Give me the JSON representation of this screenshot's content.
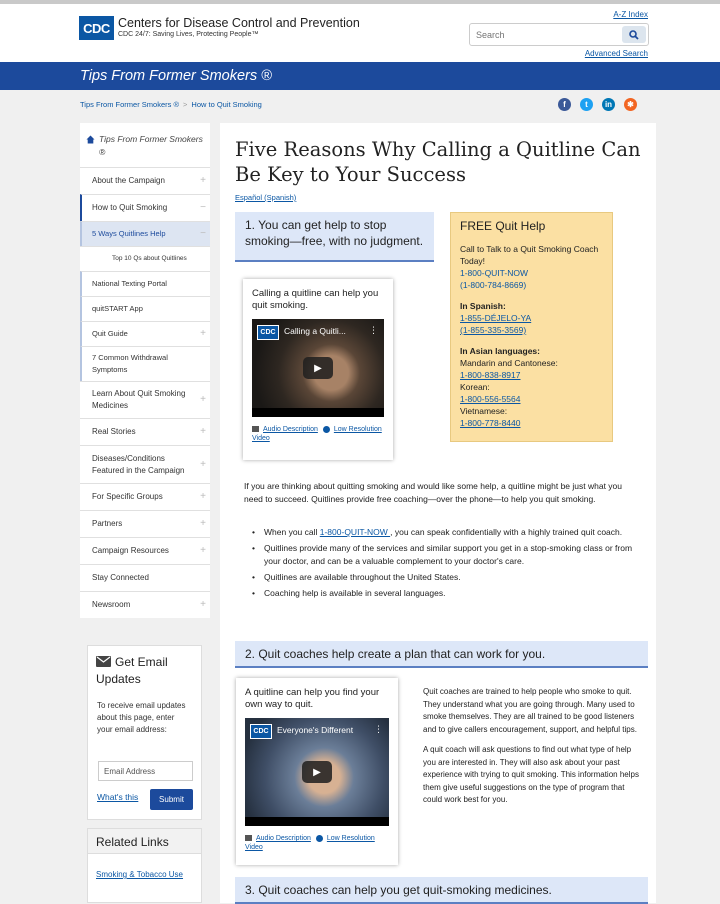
{
  "header": {
    "logo_mark": "CDC",
    "org_name": "Centers for Disease Control and Prevention",
    "tagline": "CDC 24/7: Saving Lives, Protecting People™",
    "az_index": "A-Z Index",
    "search_placeholder": "Search",
    "advanced_search": "Advanced Search",
    "search_icon": "search-icon"
  },
  "banner": {
    "title": "Tips From Former Smokers ®"
  },
  "breadcrumb": {
    "items": [
      "Tips From Former Smokers ®",
      "How to Quit Smoking"
    ],
    "separator": ">"
  },
  "social": [
    {
      "icon": "facebook-icon",
      "glyph": "f",
      "color": "#3b5998"
    },
    {
      "icon": "twitter-icon",
      "glyph": "t",
      "color": "#1da1f2"
    },
    {
      "icon": "linkedin-icon",
      "glyph": "in",
      "color": "#0077b5"
    },
    {
      "icon": "syndicate-icon",
      "glyph": "✱",
      "color": "#f26522"
    }
  ],
  "sidebar": {
    "home_label": "Tips From Former Smokers ®",
    "items": [
      {
        "label": "About the Campaign",
        "toggle": "+"
      },
      {
        "label": "How to Quit Smoking",
        "toggle": "−"
      },
      {
        "label": "5 Ways Quitlines Help",
        "toggle": "−"
      },
      {
        "label": "Top 10 Qs about Quitlines",
        "toggle": ""
      },
      {
        "label": "National Texting Portal",
        "toggle": ""
      },
      {
        "label": "quitSTART App",
        "toggle": ""
      },
      {
        "label": "Quit Guide",
        "toggle": "+"
      },
      {
        "label": "7 Common Withdrawal Symptoms",
        "toggle": ""
      },
      {
        "label": "Learn About Quit Smoking Medicines",
        "toggle": "+"
      },
      {
        "label": "Real Stories",
        "toggle": "+"
      },
      {
        "label": "Diseases/Conditions Featured in the Campaign",
        "toggle": "+"
      },
      {
        "label": "For Specific Groups",
        "toggle": "+"
      },
      {
        "label": "Partners",
        "toggle": "+"
      },
      {
        "label": "Campaign Resources",
        "toggle": "+"
      },
      {
        "label": "Stay Connected",
        "toggle": ""
      },
      {
        "label": "Newsroom",
        "toggle": "+"
      }
    ]
  },
  "email": {
    "title": "Get Email Updates",
    "text": "To receive email updates about this page, enter your email address:",
    "placeholder": "Email Address",
    "whats_this": "What's this",
    "submit": "Submit"
  },
  "related": {
    "title": "Related Links",
    "link": "Smoking & Tobacco Use"
  },
  "main": {
    "title": "Five Reasons Why Calling a Quitline Can Be Key to Your Success",
    "espanol": "Español (Spanish)",
    "reason1": "1. You can get help to stop smoking—free, with no judgment.",
    "video1": {
      "caption": "Calling a quitline can help you quit smoking.",
      "title": "Calling a Quitli...",
      "audio": "Audio Description",
      "lowres": "Low Resolution Video"
    },
    "quitbox": {
      "title": "FREE Quit Help",
      "call": "Call to Talk to a Quit Smoking Coach Today!",
      "num1": "1-800-QUIT-NOW",
      "num2": "(1-800-784-8669)",
      "spanish_label": "In Spanish:",
      "sp1": "1-855-DÉJELO-YA",
      "sp2": "(1-855-335-3569)",
      "asian_label": "In Asian languages:",
      "mandarin": "Mandarin and Cantonese:",
      "mandarin_num": "1-800-838-8917",
      "korean": "Korean:",
      "korean_num": "1-800-556-5564",
      "vietnamese": "Vietnamese:",
      "vietnamese_num": "1-800-778-8440"
    },
    "intro": "If you are thinking about quitting smoking and would like some help, a quitline might be just what you need to succeed. Quitlines provide free coaching—over the phone—to help you quit smoking.",
    "bullets": {
      "b1_pre": "When you call ",
      "b1_link": "1-800-QUIT-NOW ",
      "b1_post": ", you can speak confidentially with a highly trained quit coach.",
      "b2": "Quitlines provide many of the services and similar support you get in a stop-smoking class or from your doctor, and can be a valuable complement to your doctor's care.",
      "b3": "Quitlines are available throughout the United States.",
      "b4": "Coaching help is available in several languages."
    },
    "reason2": "2. Quit coaches help create a plan that can work for you.",
    "video2": {
      "caption": "A quitline can help you find your own way to quit.",
      "title": "Everyone's Different",
      "audio": "Audio Description",
      "lowres": "Low Resolution Video"
    },
    "reason2_p1": "Quit coaches are trained to help people who smoke to quit. They understand what you are going through. Many used to smoke themselves. They are all trained to be good listeners and to give callers encouragement, support, and helpful tips.",
    "reason2_p2": "A quit coach will ask questions to find out what type of help you are interested in. They will also ask about your past experience with trying to quit smoking. This information helps them give useful suggestions on the type of program that could work best for you.",
    "reason3": "3. Quit coaches can help you get quit-smoking medicines."
  }
}
